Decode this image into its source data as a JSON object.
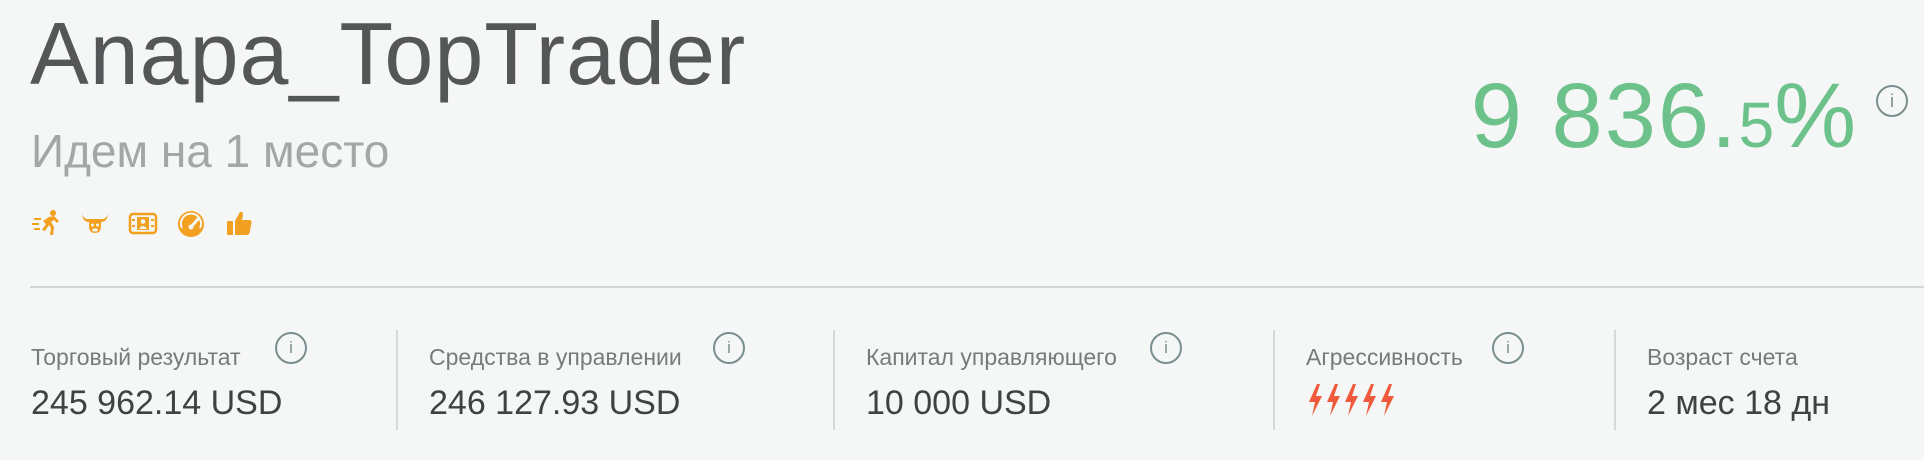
{
  "header": {
    "title": "Anapa_TopTrader",
    "subtitle": "Идем на 1 место",
    "badges": [
      "runner-icon",
      "bull-icon",
      "id-card-icon",
      "speedometer-icon",
      "thumbs-up-icon"
    ],
    "badge_color": "#f2a01f"
  },
  "return": {
    "int_part": "9 836.",
    "dec_part": "5",
    "pct": "%",
    "info": "i",
    "color": "#6cc28a"
  },
  "stats": {
    "trading_result": {
      "label": "Торговый результат",
      "value": "245 962.14 USD",
      "info": "i"
    },
    "funds_under_management": {
      "label": "Средства в управлении",
      "value": "246 127.93 USD",
      "info": "i"
    },
    "manager_capital": {
      "label": "Капитал управляющего",
      "value": "10 000 USD",
      "info": "i"
    },
    "aggressiveness": {
      "label": "Агрессивность",
      "level": 5,
      "max": 5,
      "info": "i",
      "color": "#ef5a3c"
    },
    "account_age": {
      "label": "Возраст счета",
      "value": "2 мес 18 дн"
    }
  }
}
